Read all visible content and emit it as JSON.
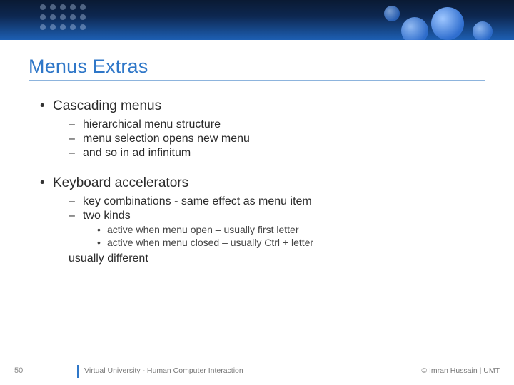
{
  "title": "Menus Extras",
  "sections": [
    {
      "heading": "Cascading menus",
      "subitems": [
        "hierarchical menu structure",
        "menu selection opens new menu",
        "and so in ad infinitum"
      ]
    },
    {
      "heading": "Keyboard accelerators",
      "subitems": [
        "key combinations - same effect as menu item",
        "two kinds"
      ],
      "subsub": [
        "active when menu open – usually first letter",
        "active when menu closed – usually Ctrl + letter"
      ],
      "trail": "usually different"
    }
  ],
  "footer": {
    "page": "50",
    "center": "Virtual University - Human Computer Interaction",
    "right": "© Imran Hussain | UMT"
  }
}
